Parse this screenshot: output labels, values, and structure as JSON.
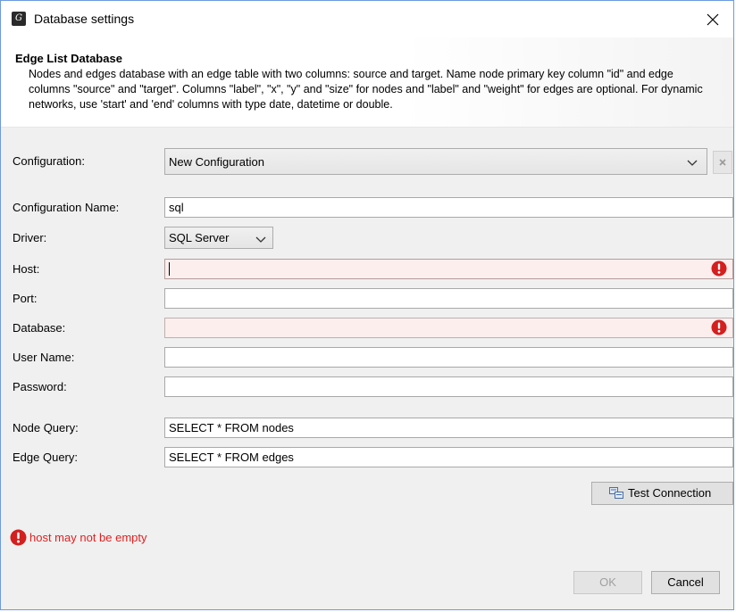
{
  "window": {
    "title": "Database settings",
    "close_glyph": "✕"
  },
  "header": {
    "title": "Edge List Database",
    "description": "Nodes and edges database with an edge table with two columns: source and target. Name node primary key column \"id\" and edge columns \"source\" and \"target\". Columns \"label\", \"x\", \"y\" and \"size\" for nodes and \"label\" and \"weight\" for edges are optional. For dynamic networks, use 'start' and 'end' columns with type date, datetime or double."
  },
  "form": {
    "configuration": {
      "label": "Configuration:",
      "selected": "New Configuration"
    },
    "configuration_name": {
      "label": "Configuration Name:",
      "value": "sql"
    },
    "driver": {
      "label": "Driver:",
      "selected": "SQL Server"
    },
    "host": {
      "label": "Host:",
      "value": "",
      "error": true
    },
    "port": {
      "label": "Port:",
      "value": ""
    },
    "database": {
      "label": "Database:",
      "value": "",
      "error": true
    },
    "user_name": {
      "label": "User Name:",
      "value": ""
    },
    "password": {
      "label": "Password:",
      "value": ""
    },
    "node_query": {
      "label": "Node Query:",
      "value": "SELECT * FROM nodes"
    },
    "edge_query": {
      "label": "Edge Query:",
      "value": "SELECT * FROM edges"
    }
  },
  "buttons": {
    "test_connection": "Test Connection",
    "ok": "OK",
    "cancel": "Cancel"
  },
  "status": {
    "message": "host may not be empty"
  },
  "colors": {
    "error_red": "#e02020",
    "error_field_bg": "#fdeeee",
    "window_border": "#6d9ae0"
  },
  "icons": {
    "app": "gephi-app-icon",
    "close": "close-icon",
    "error": "error-exclamation-icon",
    "delete": "delete-config-icon",
    "test_connection": "test-connection-icon",
    "dropdown": "chevron-down-icon"
  }
}
